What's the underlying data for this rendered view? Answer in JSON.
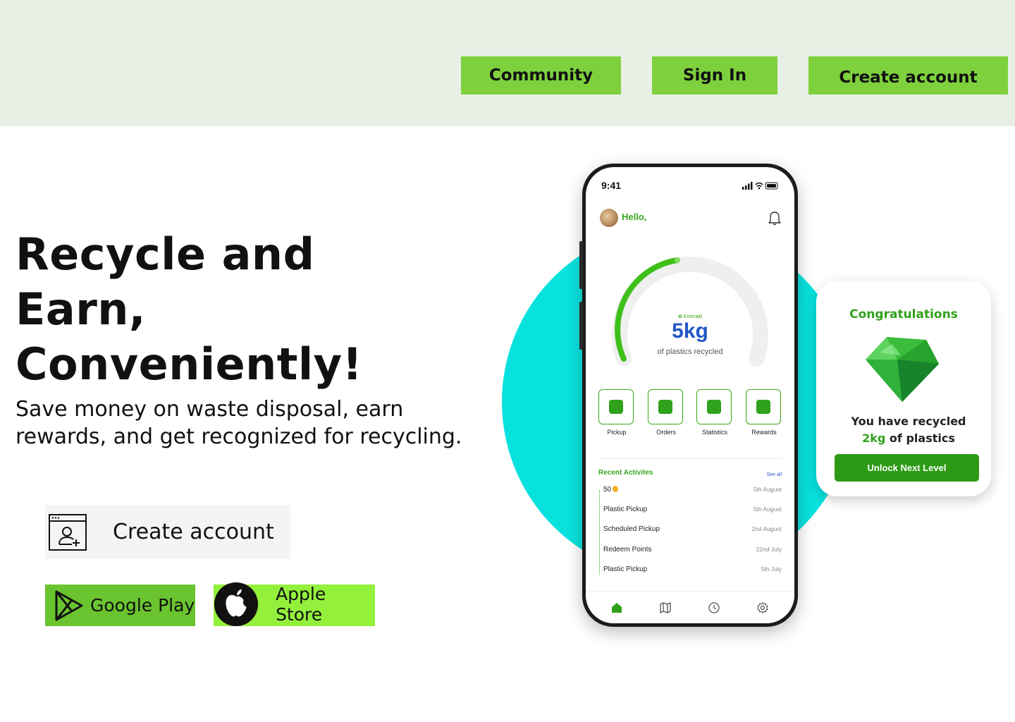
{
  "nav": {
    "community_label": "Community",
    "signin_label": "Sign In",
    "create_label": "Create account"
  },
  "hero": {
    "title": "Recycle and\nEarn,\nConveniently!",
    "subtitle": "Save money on waste disposal, earn rewards, and get recognized for recycling."
  },
  "cta": {
    "create_label": "Create account",
    "icon": "account-window-icon"
  },
  "stores": {
    "google_label": "Google Play",
    "google_icon": "google-play-icon",
    "apple_label": "Apple Store",
    "apple_icon": "apple-icon"
  },
  "phone": {
    "status_time": "9:41",
    "greeting": "Hello,",
    "gauge": {
      "brand": "Emerald",
      "value": "5kg",
      "label": "of plastics recycled"
    },
    "actions": [
      {
        "label": "Pickup",
        "icon": "truck-icon"
      },
      {
        "label": "Orders",
        "icon": "cart-icon"
      },
      {
        "label": "Statistics",
        "icon": "chart-icon"
      },
      {
        "label": "Rewards",
        "icon": "award-icon"
      }
    ],
    "recent": {
      "title": "Recent Activites",
      "see_all": "See all",
      "items": [
        {
          "label": "50",
          "date": "5th August"
        },
        {
          "label": "Plastic Pickup",
          "date": "5th August"
        },
        {
          "label": "Scheduled Pickup",
          "date": "2nd August"
        },
        {
          "label": "Redeem Points",
          "date": "22nd  July"
        },
        {
          "label": "Plastic Pickup",
          "date": "5th July"
        }
      ]
    },
    "tabs": [
      "home-icon",
      "map-icon",
      "clock-icon",
      "settings-icon"
    ]
  },
  "congrats": {
    "title": "Congratulations",
    "line1": "You have recycled",
    "amount": "2kg",
    "line2_rest": " of plastics",
    "button_label": "Unlock Next Level"
  },
  "colors": {
    "accent_green": "#7ed13d",
    "brand_green": "#2fa11a",
    "teal": "#08e2de",
    "topbar_bg": "#e8f0e6"
  }
}
